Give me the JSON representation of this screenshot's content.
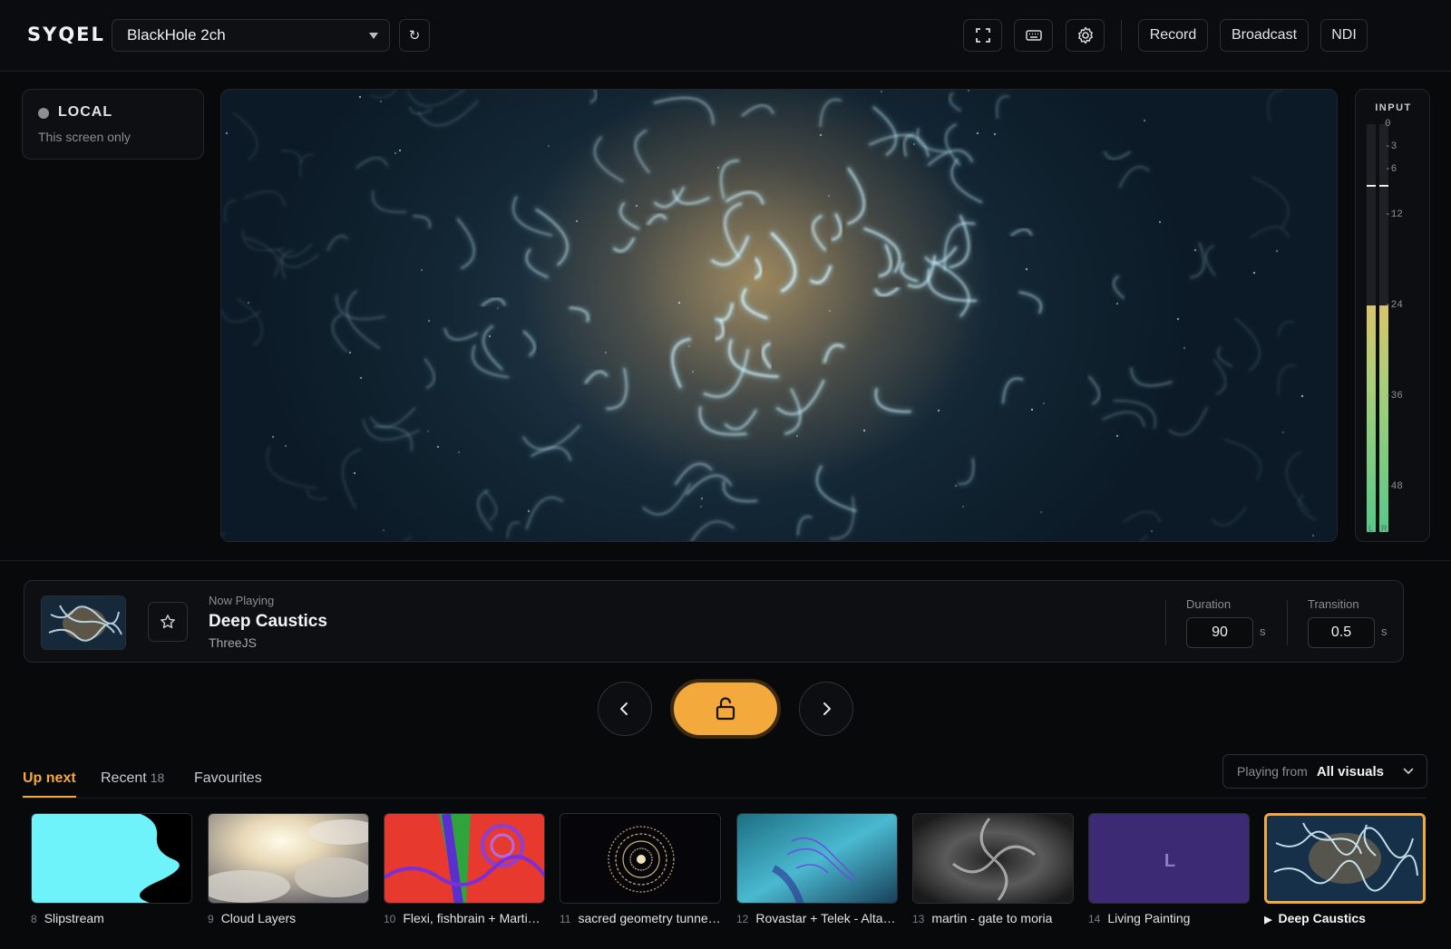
{
  "app": {
    "logo": "SYQEL"
  },
  "toolbar": {
    "device": "BlackHole 2ch",
    "refresh_glyph": "↻",
    "icons": [
      "fullscreen-icon",
      "keyboard-icon",
      "settings-icon"
    ],
    "record_label": "Record",
    "broadcast_label": "Broadcast",
    "ndi_label": "NDI"
  },
  "output": {
    "title": "LOCAL",
    "subtitle": "This screen only"
  },
  "meter": {
    "title": "INPUT",
    "ticks": [
      "0",
      "-3",
      "-6",
      "-12",
      "-24",
      "-36",
      "-48"
    ],
    "channels": [
      "L",
      "R"
    ],
    "level_db": -24,
    "peak_db": -8
  },
  "now_playing": {
    "label": "Now Playing",
    "title": "Deep Caustics",
    "engine": "ThreeJS",
    "duration_label": "Duration",
    "duration_value": "90",
    "duration_unit": "s",
    "transition_label": "Transition",
    "transition_value": "0.5",
    "transition_unit": "s"
  },
  "transport": {
    "icons": [
      "chevron-left-icon",
      "lock-open-icon",
      "chevron-right-icon"
    ]
  },
  "tabs": {
    "up_next": "Up next",
    "recent": "Recent",
    "recent_count": "18",
    "favourites": "Favourites",
    "playing_from_label": "Playing from",
    "playing_from_value": "All visuals"
  },
  "queue": [
    {
      "num": "8",
      "title": "Slipstream"
    },
    {
      "num": "9",
      "title": "Cloud Layers"
    },
    {
      "num": "10",
      "title": "Flexi, fishbrain + Marti…"
    },
    {
      "num": "11",
      "title": "sacred geometry tunne…"
    },
    {
      "num": "12",
      "title": "Rovastar + Telek - Alta…"
    },
    {
      "num": "13",
      "title": "martin - gate to moria"
    },
    {
      "num": "14",
      "title": "Living Painting",
      "letter": "L"
    },
    {
      "num": "",
      "title": "Deep Caustics",
      "current": true
    }
  ],
  "colors": {
    "accent": "#f3a93c",
    "background": "#08090b",
    "panel": "#0e0f12"
  }
}
